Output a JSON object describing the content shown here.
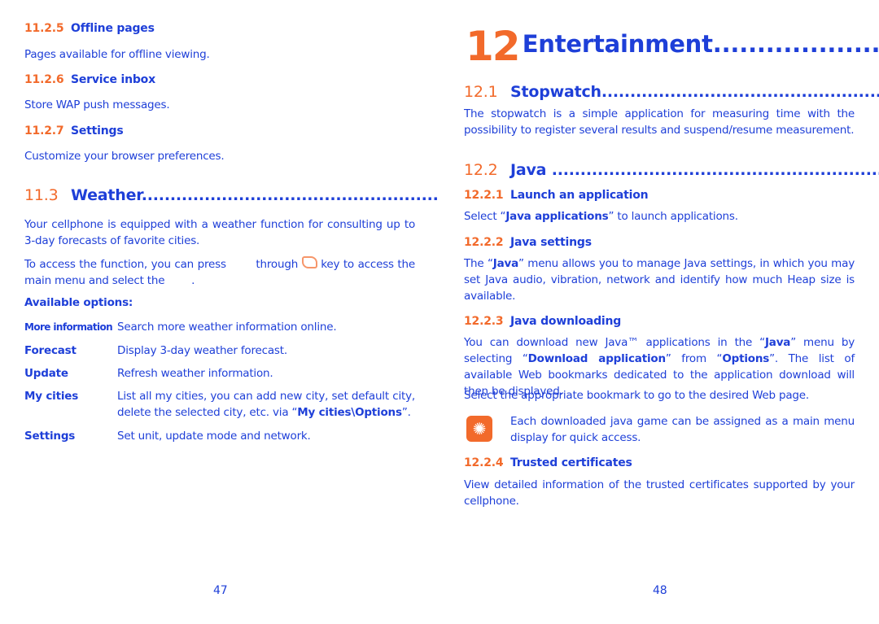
{
  "left": {
    "s1125": {
      "num": "11.2.5",
      "title": "Offline pages",
      "body": "Pages available for offline viewing."
    },
    "s1126": {
      "num": "11.2.6",
      "title": "Service inbox",
      "body": "Store WAP push messages."
    },
    "s1127": {
      "num": "11.2.7",
      "title": "Settings",
      "body": "Customize your browser preferences."
    },
    "s113": {
      "num": "11.3",
      "title": "Weather....................................................",
      "p1": "Your cellphone is equipped with a weather function for consulting up to 3-day forecasts of favorite cities.",
      "p2a": "To access the function, you can press",
      "p2b": "through",
      "p2c": "key to access the main menu and select the",
      "p2d": ".",
      "options_label": "Available options:",
      "options": [
        {
          "k": "More information",
          "v": "Search more weather information online."
        },
        {
          "k": "Forecast",
          "v": "Display 3-day weather forecast."
        },
        {
          "k": "Update",
          "v": "Refresh weather information."
        },
        {
          "k": "My cities",
          "v": "List all my cities, you can add new city, set default city, delete the selected city, etc. via “",
          "vb": "My cities\\Options",
          "ve": "”."
        },
        {
          "k": "Settings",
          "v": "Set unit, update mode and network."
        }
      ]
    },
    "page": "47"
  },
  "right": {
    "chapter": {
      "num": "12",
      "title": "Entertainment",
      "dots": "..................."
    },
    "s121": {
      "num": "12.1",
      "title": "Stopwatch.......................................................",
      "body": "The stopwatch is a simple application for measuring time with the possibility to register several results and suspend/resume measurement."
    },
    "s122": {
      "num": "12.2",
      "title": "Java ................................................................"
    },
    "s1221": {
      "num": "12.2.1",
      "title": "Launch an application",
      "a": "Select “",
      "b": "Java applications",
      "c": "” to launch applications."
    },
    "s1222": {
      "num": "12.2.2",
      "title": "Java settings",
      "a": "The “",
      "b": "Java",
      "c": "” menu allows you to manage Java settings, in which you may set Java audio, vibration, network and identify how much Heap size is available."
    },
    "s1223": {
      "num": "12.2.3",
      "title": "Java downloading",
      "a": "You can download new Java™ applications in the “",
      "b": "Java",
      "c": "” menu by selecting “",
      "d": "Download application",
      "e": "” from “",
      "f": "Options",
      "g": "”. The list of available Web bookmarks dedicated to the application download will then be displayed.",
      "p2": "Select the appropriate bookmark to go to the desired Web page.",
      "tip": "Each downloaded java game can be assigned as a main menu display for quick access."
    },
    "s1224": {
      "num": "12.2.4",
      "title": "Trusted certificates",
      "body": "View detailed information of the trusted certificates supported by your cellphone."
    },
    "page": "48"
  },
  "colors": {
    "blue": "#1e3fd8",
    "orange": "#f26a2b"
  },
  "icons": {
    "key": "navigation-key-icon",
    "tip": "lightbulb-tip-icon"
  }
}
